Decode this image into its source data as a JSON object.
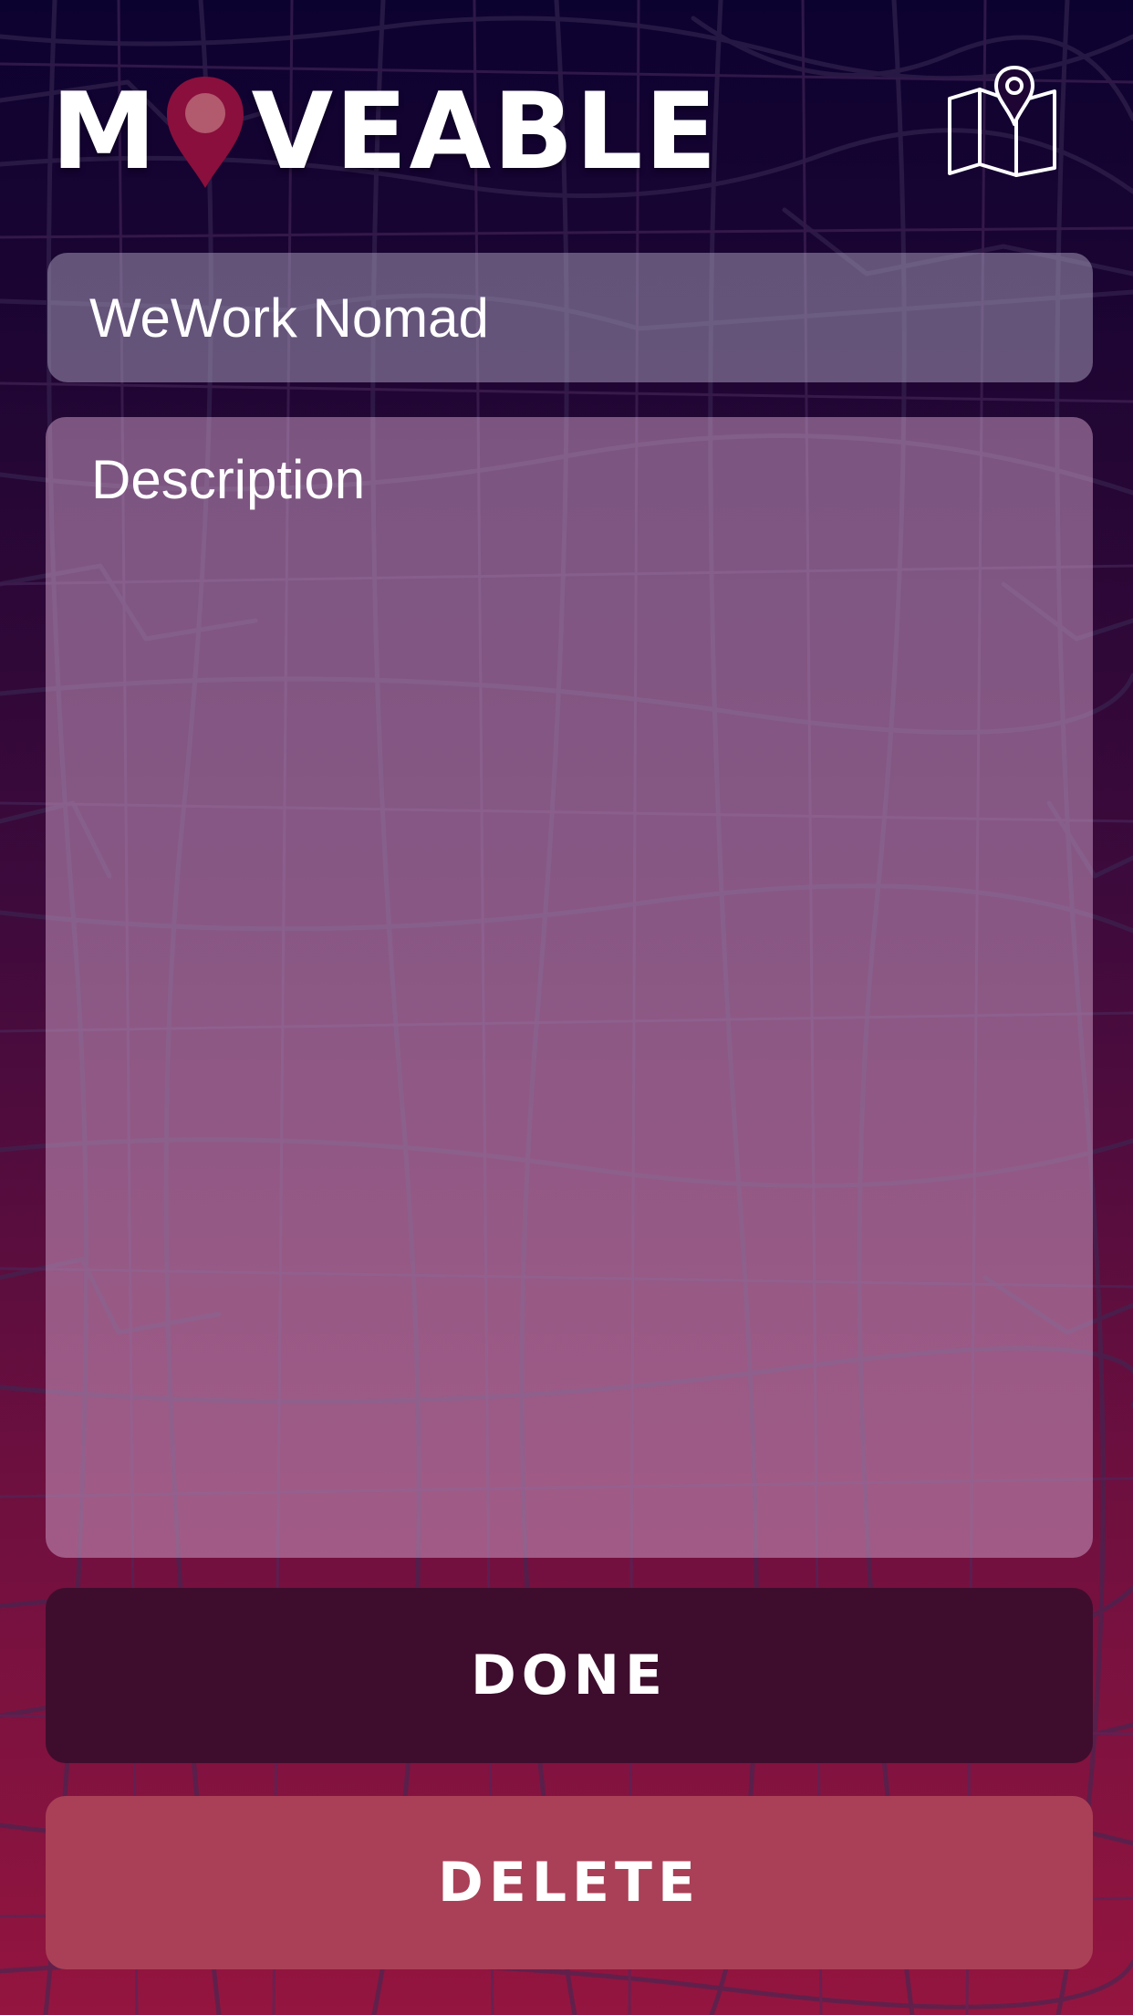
{
  "app": {
    "logo_before": "M",
    "logo_after": "VEABLE",
    "brand_pin_color": "#8a0f3c",
    "map_button_icon": "map-location-icon"
  },
  "form": {
    "title_value": "WeWork Nomad",
    "description_value": "",
    "description_placeholder": "Description"
  },
  "actions": {
    "done_label": "DONE",
    "delete_label": "DELETE",
    "done_color": "#3e0d2d",
    "delete_color": "#aa4057"
  }
}
